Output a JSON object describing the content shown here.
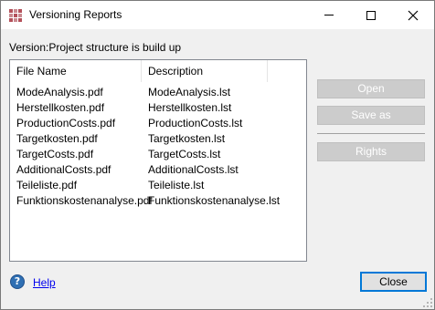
{
  "window": {
    "title": "Versioning Reports"
  },
  "version_label": "Version:Project structure is build up",
  "list": {
    "columns": {
      "name": "File Name",
      "description": "Description"
    },
    "rows": [
      {
        "name": "ModeAnalysis.pdf",
        "description": "ModeAnalysis.lst"
      },
      {
        "name": "Herstellkosten.pdf",
        "description": "Herstellkosten.lst"
      },
      {
        "name": "ProductionCosts.pdf",
        "description": "ProductionCosts.lst"
      },
      {
        "name": "Targetkosten.pdf",
        "description": "Targetkosten.lst"
      },
      {
        "name": "TargetCosts.pdf",
        "description": "TargetCosts.lst"
      },
      {
        "name": "AdditionalCosts.pdf",
        "description": "AdditionalCosts.lst"
      },
      {
        "name": "Teileliste.pdf",
        "description": "Teileliste.lst"
      },
      {
        "name": "Funktionskostenanalyse.pdf",
        "description": "Funktionskostenanalyse.lst"
      }
    ]
  },
  "buttons": {
    "open": "Open",
    "save_as": "Save as",
    "rights": "Rights",
    "close": "Close"
  },
  "help": {
    "label": "Help",
    "icon": "help-icon"
  },
  "colors": {
    "accent": "#0078d7",
    "link": "#0000ee"
  }
}
